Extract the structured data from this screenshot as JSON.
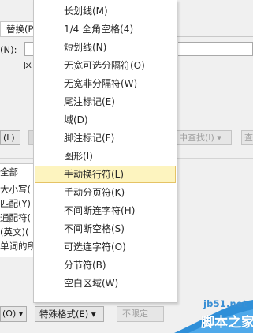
{
  "dialog": {
    "tab_replace": "替换(P)",
    "find_label": "(N):",
    "options_label": "区",
    "btn_less": "(L)",
    "btn_find_in": "中查找(I)",
    "find_in_arrow": "▾",
    "btn_find_next": "查",
    "options": [
      "全部",
      "大小写(",
      "匹配(Y)",
      "通配符(",
      "(英文)(",
      "单词的所"
    ],
    "btn_format": "(O) ▾",
    "btn_special": "特殊格式(E)",
    "btn_special_arrow": "▾",
    "btn_no_format": "不限定"
  },
  "menu": {
    "items": [
      "长划线(M)",
      "1/4 全角空格(4)",
      "短划线(N)",
      "无宽可选分隔符(O)",
      "无宽非分隔符(W)",
      "尾注标记(E)",
      "域(D)",
      "脚注标记(F)",
      "图形(I)",
      "手动换行符(L)",
      "手动分页符(K)",
      "不间断连字符(H)",
      "不间断空格(S)",
      "可选连字符(O)",
      "分节符(B)",
      "空白区域(W)"
    ],
    "highlighted_index": 9,
    "highlight_color": "#fdf4bf",
    "highlight_border": "#e5c365"
  },
  "watermark": {
    "site": "jb51.net",
    "title": "脚本之家",
    "color": "#3a8fd4"
  }
}
